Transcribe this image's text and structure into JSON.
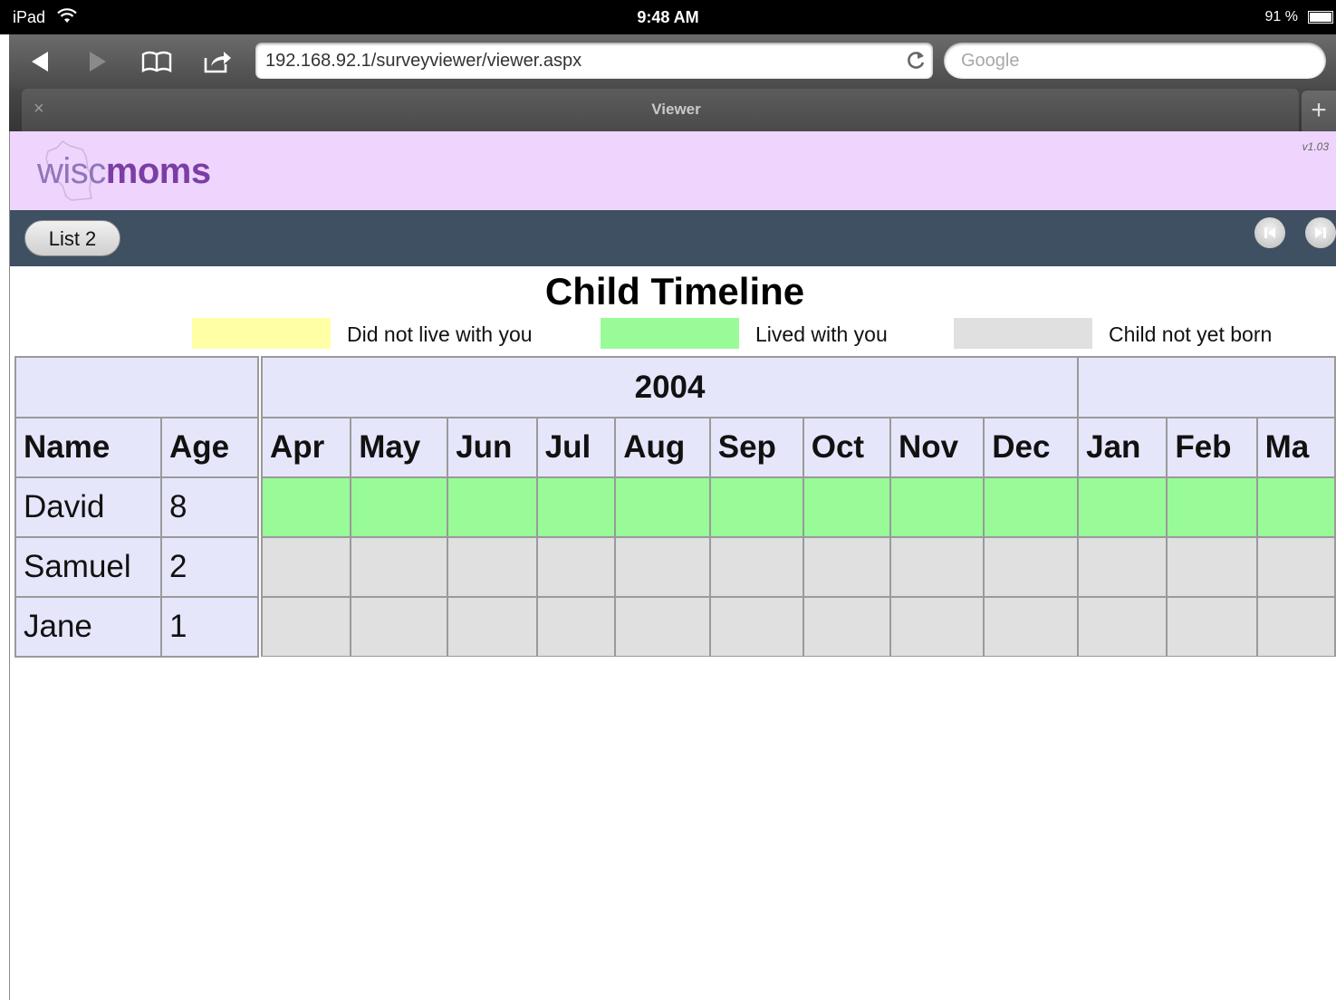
{
  "status_bar": {
    "device": "iPad",
    "time": "9:48 AM",
    "battery": "91 %",
    "battery_level": 0.91
  },
  "browser": {
    "url": "192.168.92.1/surveyviewer/viewer.aspx",
    "search_placeholder": "Google",
    "tab_title": "Viewer",
    "tab_close": "×",
    "new_tab": "+"
  },
  "app": {
    "logo_wisc": "wisc",
    "logo_moms": "moms",
    "version": "v1.03",
    "list_button": "List 2"
  },
  "page": {
    "title": "Child Timeline"
  },
  "legend": [
    {
      "label": "Did not live with you",
      "color": "#ffffa6"
    },
    {
      "label": "Lived with you",
      "color": "#98fb98"
    },
    {
      "label": "Child not yet born",
      "color": "#e0e0e0"
    }
  ],
  "table": {
    "name_header": "Name",
    "age_header": "Age",
    "year": "2004",
    "months": [
      "Apr",
      "May",
      "Jun",
      "Jul",
      "Aug",
      "Sep",
      "Oct",
      "Nov",
      "Dec",
      "Jan",
      "Feb",
      "Ma"
    ],
    "children": [
      {
        "name": "David",
        "age": "8",
        "status": "lived"
      },
      {
        "name": "Samuel",
        "age": "2",
        "status": "not-born"
      },
      {
        "name": "Jane",
        "age": "1",
        "status": "not-born"
      }
    ]
  },
  "colors": {
    "lived": "#98fb98",
    "not_born": "#e0e0e0",
    "did_not_live": "#ffffa6",
    "header_bg": "#efd5fd",
    "nav_bg": "#3e5062"
  }
}
